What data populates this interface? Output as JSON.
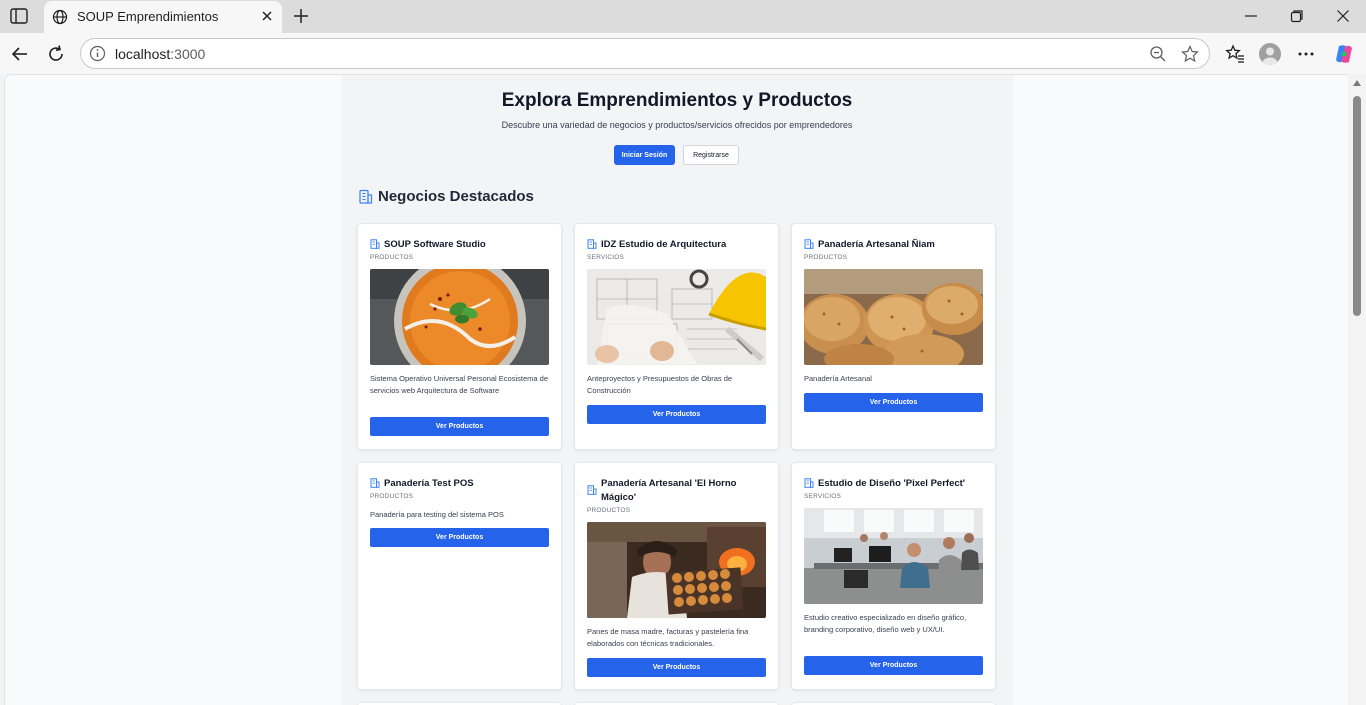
{
  "browser": {
    "tab_title": "SOUP Emprendimientos",
    "url_host": "localhost",
    "url_port": ":3000"
  },
  "hero": {
    "title": "Explora Emprendimientos y Productos",
    "subtitle": "Descubre una variedad de negocios y productos/servicios ofrecidos por emprendedores",
    "login_label": "Iniciar Sesión",
    "register_label": "Registrarse"
  },
  "section": {
    "title": "Negocios Destacados"
  },
  "businesses": [
    {
      "name": "SOUP Software Studio",
      "category": "PRODUCTOS",
      "description": "Sistema Operativo Universal Personal Ecosistema de servicios web Arquitectura de Software",
      "button": "Ver Productos",
      "image": "soup-bowl"
    },
    {
      "name": "IDZ Estudio de Arquitectura",
      "category": "SERVICIOS",
      "description": "Anteproyectos y Presupuestos de Obras de Construcción",
      "button": "Ver Productos",
      "image": "architecture-plans"
    },
    {
      "name": "Panadería Artesanal Ñiam",
      "category": "PRODUCTOS",
      "description": "Panadería Artesanal",
      "button": "Ver Productos",
      "image": "bread-scones"
    },
    {
      "name": "Panadería Test POS",
      "category": "PRODUCTOS",
      "description": "Panadería para testing del sistema POS",
      "button": "Ver Productos"
    },
    {
      "name": "Panadería Artesanal 'El Horno Mágico'",
      "category": "PRODUCTOS",
      "description": "Panes de masa madre, facturas y pastelería fina elaborados con técnicas tradicionales.",
      "button": "Ver Productos",
      "image": "baker-oven"
    },
    {
      "name": "Estudio de Diseño 'Pixel Perfect'",
      "category": "SERVICIOS",
      "description": "Estudio creativo especializado en diseño gráfico, branding corporativo, diseño web y UX/UI.",
      "button": "Ver Productos",
      "image": "design-office"
    }
  ],
  "colors": {
    "primary": "#2563eb",
    "page_bg": "#f3f4f6",
    "card_bg": "#ffffff"
  }
}
